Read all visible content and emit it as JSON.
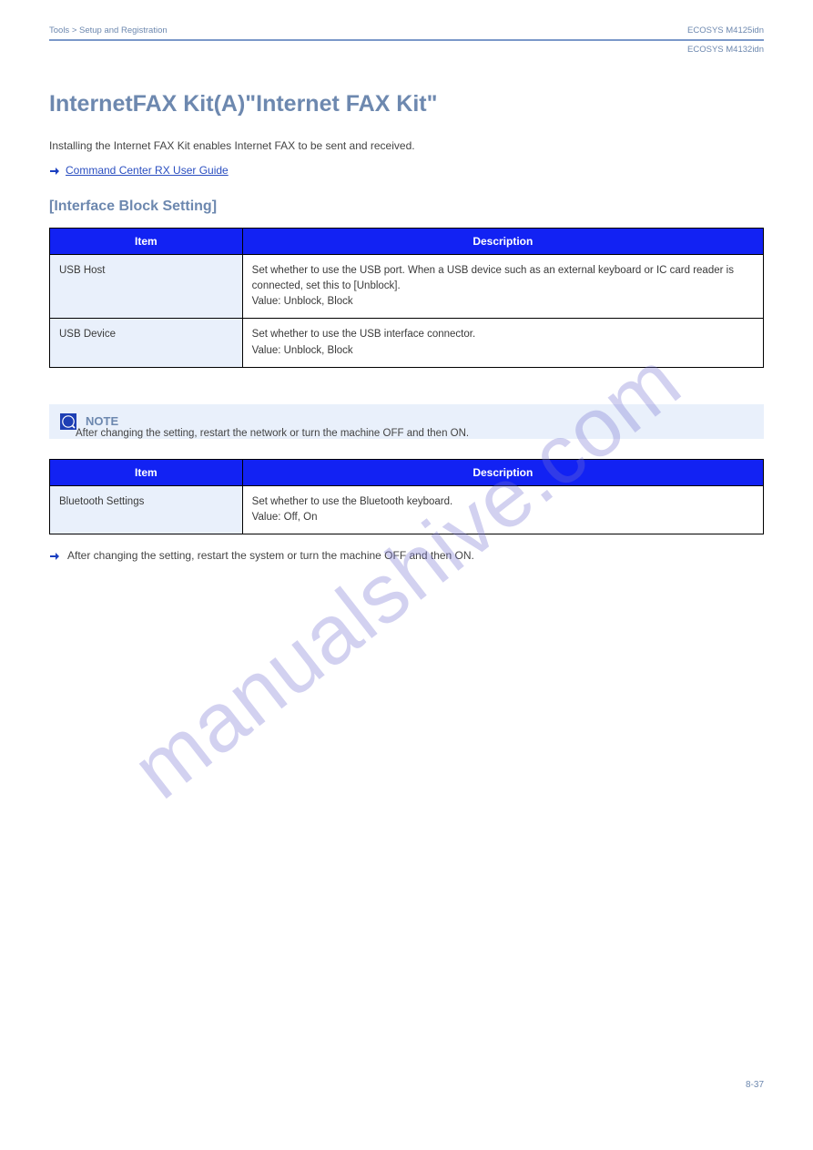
{
  "header": {
    "left": "Tools > Setup and Registration",
    "right_top": "ECOSYS M4125idn",
    "right_sub": "ECOSYS M4132idn"
  },
  "h1": "InternetFAX Kit(A)\"Internet FAX Kit\"",
  "intro": "Installing the Internet FAX Kit enables Internet FAX to be sent and received.",
  "link": "Command Center RX User Guide",
  "h2": "[Interface Block Setting]",
  "table1": {
    "col_item": "Item",
    "col_desc": "Description",
    "rows": [
      {
        "label": "USB Host",
        "desc": "Set whether to use the USB port. When a USB device such as an external keyboard or IC card reader is connected, set this to [Unblock].\nValue: Unblock, Block"
      },
      {
        "label": "USB Device",
        "desc": "Set whether to use the USB interface connector.\nValue: Unblock, Block"
      }
    ]
  },
  "note": {
    "title": "NOTE",
    "text": "After changing the setting, restart the network or turn the machine OFF and then ON."
  },
  "table2": {
    "col_item": "Item",
    "col_desc": "Description",
    "rows": [
      {
        "label": "Bluetooth Settings",
        "desc": "Set whether to use the Bluetooth keyboard.\nValue: Off, On"
      }
    ]
  },
  "bullet": {
    "text": "After changing the setting, restart the system or turn the machine OFF and then ON."
  },
  "page_number": "8-37"
}
